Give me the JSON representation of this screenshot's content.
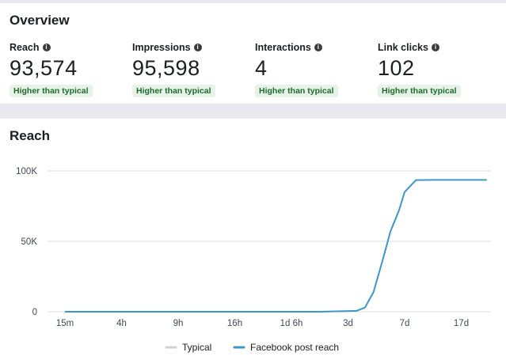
{
  "overview": {
    "title": "Overview",
    "metrics": [
      {
        "label": "Reach",
        "value": "93,574",
        "badge": "Higher than typical",
        "icon": "info-icon"
      },
      {
        "label": "Impressions",
        "value": "95,598",
        "badge": "Higher than typical",
        "icon": "info-icon"
      },
      {
        "label": "Interactions",
        "value": "4",
        "badge": "Higher than typical",
        "icon": "info-icon"
      },
      {
        "label": "Link clicks",
        "value": "102",
        "badge": "Higher than typical",
        "icon": "info-icon"
      }
    ]
  },
  "reach": {
    "title": "Reach"
  },
  "colors": {
    "line": "#3d96c8",
    "typical": "#d0d2d6",
    "badge_bg": "#e7f3e8",
    "badge_text": "#1e6b2c"
  },
  "chart_data": {
    "type": "line",
    "x_ticks": [
      "15m",
      "4h",
      "9h",
      "16h",
      "1d 6h",
      "3d",
      "7d",
      "17d"
    ],
    "y_ticks": [
      "0",
      "50K",
      "100K"
    ],
    "ylim": [
      0,
      100000
    ],
    "grid": true,
    "legend_position": "bottom",
    "series": [
      {
        "name": "Typical",
        "x": [],
        "y": []
      },
      {
        "name": "Facebook post reach",
        "x": [
          0,
          1,
          2,
          3,
          4,
          4.5,
          5,
          5.15,
          5.3,
          5.45,
          5.6,
          5.75,
          5.9,
          6,
          6.2,
          6.5,
          7,
          7.45
        ],
        "y": [
          0,
          0,
          0,
          0,
          0,
          0,
          500,
          600,
          3000,
          14000,
          35000,
          57000,
          72000,
          85000,
          93500,
          93574,
          93574,
          93574
        ]
      }
    ]
  }
}
